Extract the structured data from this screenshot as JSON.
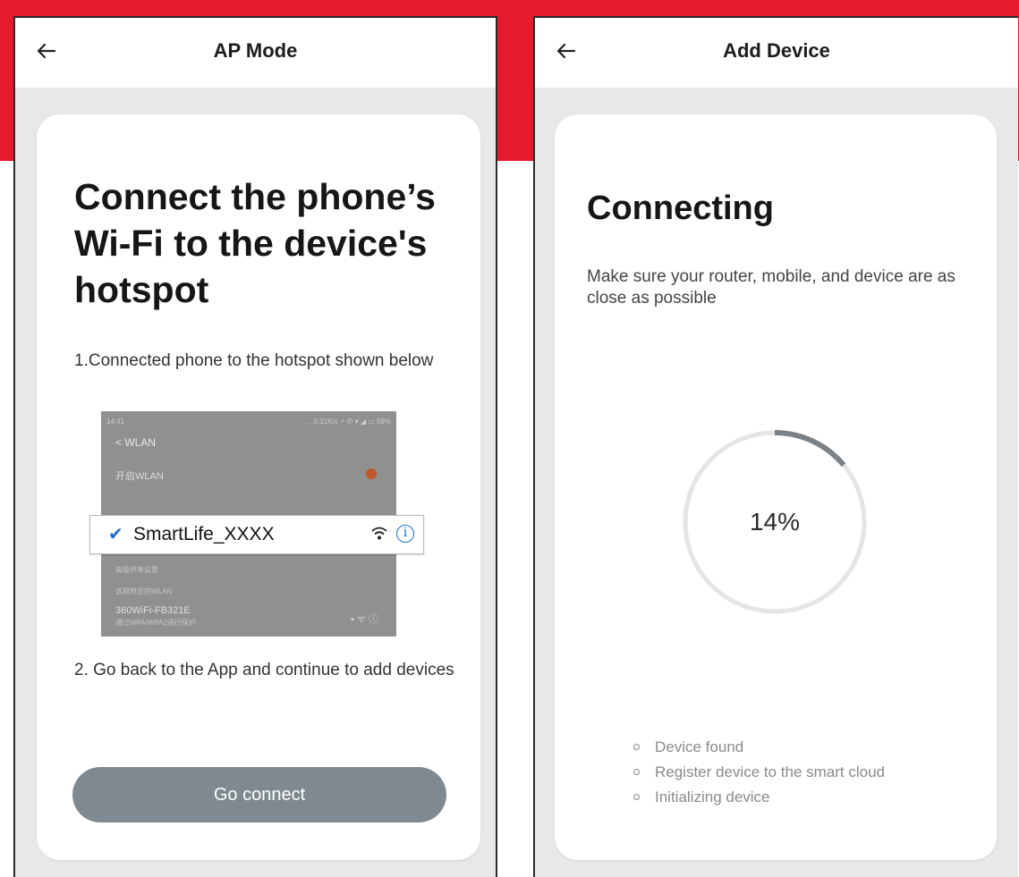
{
  "colors": {
    "brand_red": "#e31b2c",
    "button_gray": "#7f8a90",
    "progress_arc": "#7a8288",
    "progress_track": "#e5e5e5",
    "check_blue": "#1e6fcf"
  },
  "left": {
    "header": {
      "back_icon": "arrow-left-icon",
      "title": "AP Mode"
    },
    "card": {
      "title": "Connect the phone’s Wi-Fi to the device's hotspot",
      "step1": "1.Connected phone to the hotspot shown below",
      "illustration": {
        "status_time": "14:41",
        "status_icons": "... 0.31K/s ⚡ ✆ ▾ ◢ ▭ 59%",
        "screen_title": "WLAN",
        "row_enable": "开启WLAN",
        "row_sub": "高级共享设置",
        "row_section": "选取附近的WLAN",
        "row_network": "360WiFi-FB321E",
        "row_network_sub": "通过WPA/WPA2进行保护",
        "hotspot_name": "SmartLife_XXXX",
        "check_icon": "checkmark-icon",
        "wifi_icon": "wifi-icon",
        "info_icon": "info-icon",
        "info_glyph": "i"
      },
      "step2": "2. Go back to the App and continue to add devices",
      "button": "Go connect"
    }
  },
  "right": {
    "header": {
      "back_icon": "arrow-left-icon",
      "title": "Add Device"
    },
    "card": {
      "title": "Connecting",
      "subtitle": "Make sure your router, mobile, and device are as close as possible",
      "progress": {
        "percent": 14,
        "label": "14%"
      },
      "statuses": [
        "Device found",
        "Register device to the smart cloud",
        "Initializing device"
      ]
    }
  }
}
